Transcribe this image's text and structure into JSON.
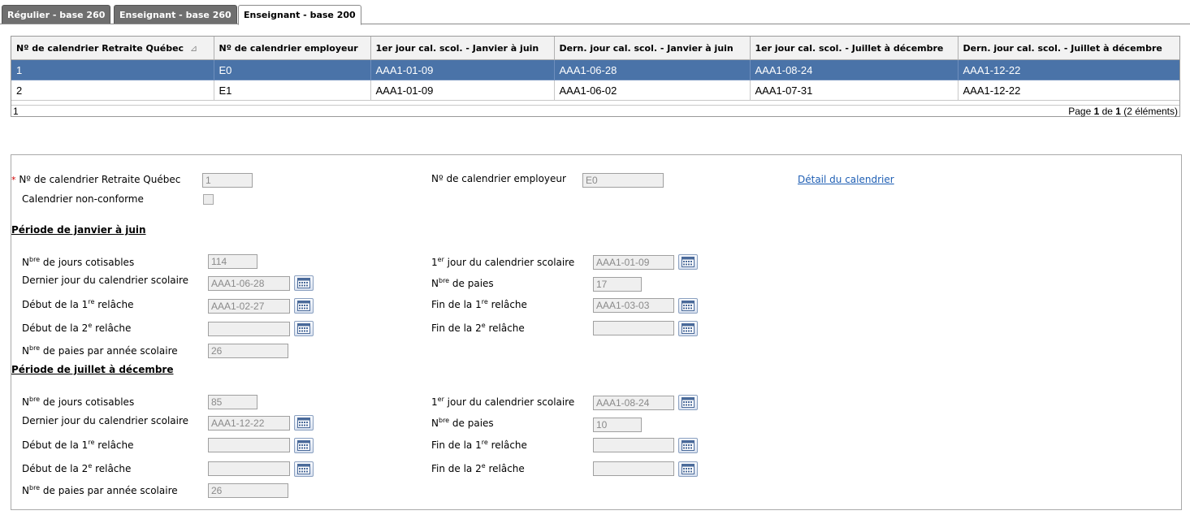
{
  "tabs": [
    {
      "label": "Régulier - base 260"
    },
    {
      "label": "Enseignant - base 260"
    },
    {
      "label": "Enseignant - base 200"
    }
  ],
  "grid": {
    "columns": [
      "Nº de calendrier Retraite Québec",
      "Nº de calendrier employeur",
      "1er jour cal. scol. - Janvier à juin",
      "Dern. jour cal. scol. - Janvier à juin",
      "1er jour cal. scol. - Juillet à décembre",
      "Dern. jour cal. scol. - Juillet à décembre"
    ],
    "sort_indicator": "⊿",
    "rows": [
      [
        "1",
        "E0",
        "AAA1-01-09",
        "AAA1-06-28",
        "AAA1-08-24",
        "AAA1-12-22"
      ],
      [
        "2",
        "E1",
        "AAA1-01-09",
        "AAA1-06-02",
        "AAA1-07-31",
        "AAA1-12-22"
      ]
    ],
    "footer_left": "1",
    "pager": {
      "prefix": "Page ",
      "current": "1",
      "of": " de ",
      "total": "1",
      "suffix": " (2 éléments)"
    }
  },
  "detail": {
    "required_mark": "*",
    "rq_label": " Nº de calendrier Retraite Québec",
    "rq_value": "1",
    "nonconf_label": "Calendrier non-conforme",
    "employer_label": "Nº de calendrier employeur",
    "employer_value": "E0",
    "detail_link": "Détail du calendrier",
    "labels": {
      "jours_a": "N",
      "jours_sup": "bre",
      "jours_b": " de jours cotisables",
      "dernier": "Dernier jour du calendrier scolaire",
      "deb1_a": "Début de la 1",
      "deb1_sup": "re",
      "deb1_b": " relâche",
      "deb2_a": "Début de la 2",
      "deb2_sup": "e",
      "deb2_b": " relâche",
      "paies_an_a": "N",
      "paies_an_sup": "bre",
      "paies_an_b": " de paies par année scolaire",
      "premier_a": "1",
      "premier_sup": "er",
      "premier_b": " jour du calendrier scolaire",
      "paies_a": "N",
      "paies_sup": "bre",
      "paies_b": " de paies",
      "fin1_a": "Fin de la 1",
      "fin1_sup": "re",
      "fin1_b": " relâche",
      "fin2_a": "Fin de la 2",
      "fin2_sup": "e",
      "fin2_b": " relâche"
    },
    "period1": {
      "title": "Période de janvier à juin",
      "jours": "114",
      "dernier": "AAA1-06-28",
      "deb1": "AAA1-02-27",
      "deb2": "",
      "paies_an": "26",
      "premier": "AAA1-01-09",
      "paies": "17",
      "fin1": "AAA1-03-03",
      "fin2": ""
    },
    "period2": {
      "title": "Période de juillet à décembre",
      "jours": "85",
      "dernier": "AAA1-12-22",
      "deb1": "",
      "deb2": "",
      "paies_an": "26",
      "premier": "AAA1-08-24",
      "paies": "10",
      "fin1": "",
      "fin2": ""
    }
  }
}
